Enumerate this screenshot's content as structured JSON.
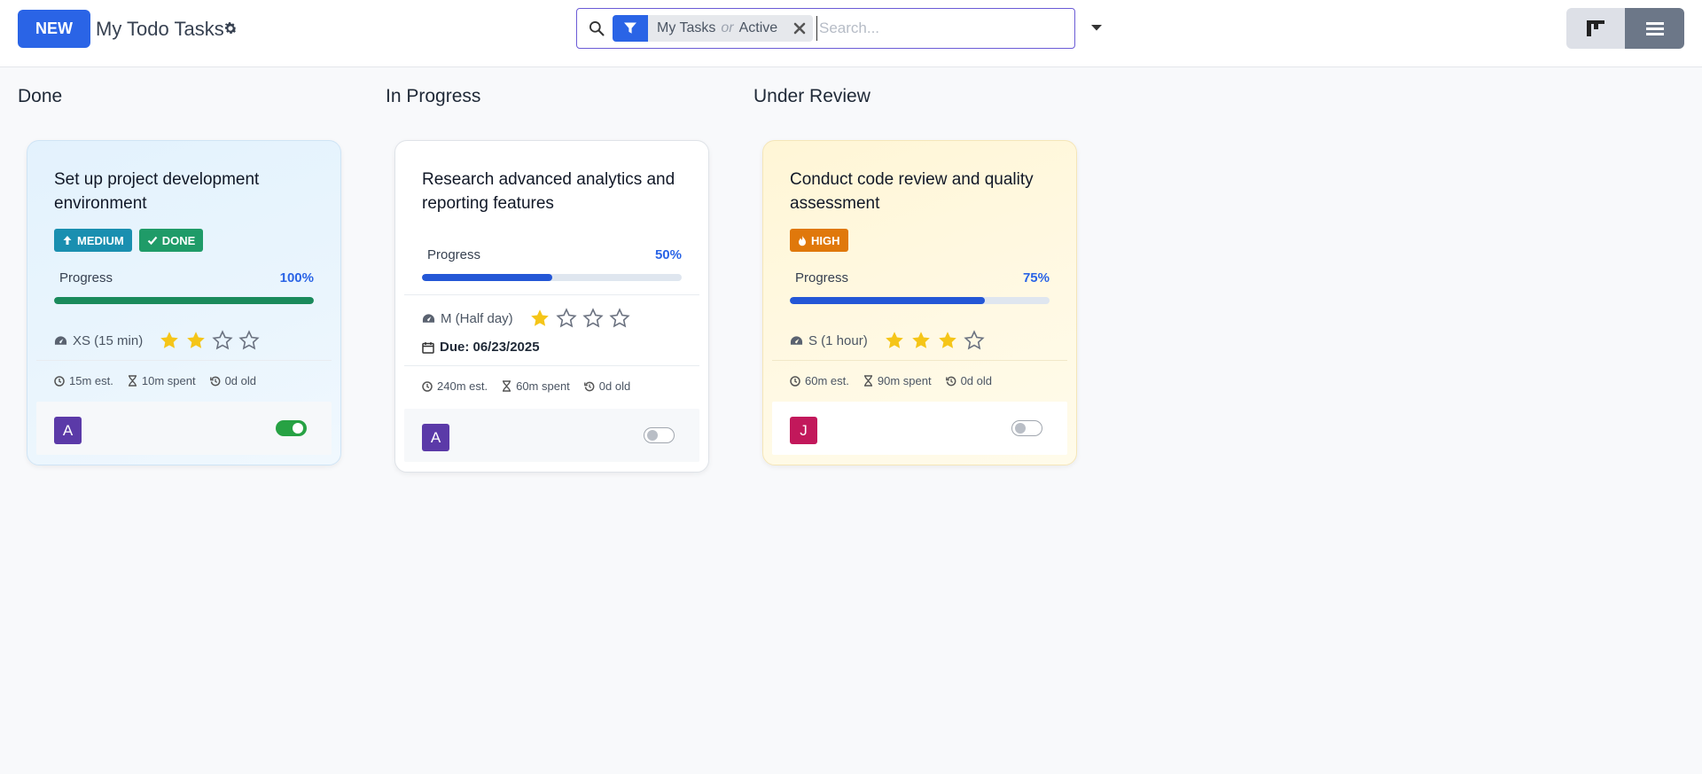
{
  "control_panel": {
    "new_button": "NEW",
    "title": "My Todo Tasks",
    "search": {
      "facet_part1": "My Tasks",
      "facet_or": "or",
      "facet_part2": "Active",
      "placeholder": "Search..."
    }
  },
  "colors": {
    "primary": "#2a64e6",
    "progress_done": "#1a8a5c",
    "progress_blue": "#2457d6",
    "star": "#f5c518"
  },
  "columns": [
    {
      "title": "Done",
      "card": {
        "title": "Set up project development environment",
        "badges": [
          "MEDIUM",
          "DONE"
        ],
        "progress_label": "Progress",
        "progress_pct": "100%",
        "progress": 1.0,
        "size": "XS (15 min)",
        "stars": 2,
        "est": "15m est.",
        "spent": "10m spent",
        "age": "0d old",
        "avatar": "A",
        "toggle": true
      }
    },
    {
      "title": "In Progress",
      "card": {
        "title": "Research advanced analytics and reporting features",
        "progress_label": "Progress",
        "progress_pct": "50%",
        "progress": 0.5,
        "size": "M (Half day)",
        "stars": 1,
        "due": "Due: 06/23/2025",
        "est": "240m est.",
        "spent": "60m spent",
        "age": "0d old",
        "avatar": "A",
        "toggle": false
      }
    },
    {
      "title": "Under Review",
      "card": {
        "title": "Conduct code review and quality assessment",
        "badges": [
          "HIGH"
        ],
        "progress_label": "Progress",
        "progress_pct": "75%",
        "progress": 0.75,
        "size": "S (1 hour)",
        "stars": 3,
        "est": "60m est.",
        "spent": "90m spent",
        "age": "0d old",
        "avatar": "J",
        "toggle": false
      }
    }
  ]
}
